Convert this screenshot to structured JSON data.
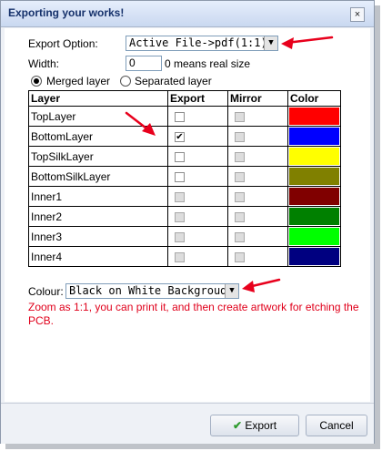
{
  "window": {
    "title": "Exporting your works!",
    "close_label": "×"
  },
  "export_option": {
    "label": "Export Option:",
    "value": "Active File->pdf(1:1)"
  },
  "width": {
    "label": "Width:",
    "value": "0",
    "hint": "0 means real size"
  },
  "layer_mode": {
    "merged_label": "Merged layer",
    "separated_label": "Separated layer",
    "selected": "merged"
  },
  "table": {
    "headers": {
      "layer": "Layer",
      "export": "Export",
      "mirror": "Mirror",
      "color": "Color"
    },
    "rows": [
      {
        "name": "TopLayer",
        "export": false,
        "export_enabled": true,
        "mirror_enabled": false,
        "color": "#ff0000"
      },
      {
        "name": "BottomLayer",
        "export": true,
        "export_enabled": true,
        "mirror_enabled": false,
        "color": "#0000ff"
      },
      {
        "name": "TopSilkLayer",
        "export": false,
        "export_enabled": true,
        "mirror_enabled": false,
        "color": "#ffff00"
      },
      {
        "name": "BottomSilkLayer",
        "export": false,
        "export_enabled": true,
        "mirror_enabled": false,
        "color": "#808000"
      },
      {
        "name": "Inner1",
        "export": false,
        "export_enabled": false,
        "mirror_enabled": false,
        "color": "#800000"
      },
      {
        "name": "Inner2",
        "export": false,
        "export_enabled": false,
        "mirror_enabled": false,
        "color": "#008000"
      },
      {
        "name": "Inner3",
        "export": false,
        "export_enabled": false,
        "mirror_enabled": false,
        "color": "#00ff00"
      },
      {
        "name": "Inner4",
        "export": false,
        "export_enabled": false,
        "mirror_enabled": false,
        "color": "#000080"
      }
    ]
  },
  "colour": {
    "label": "Colour:",
    "value": "Black on White Backgroud"
  },
  "note": "Zoom as 1:1, you can print it, and then create artwork for etching the PCB.",
  "buttons": {
    "export": "Export",
    "cancel": "Cancel"
  },
  "colors": {
    "annotation_arrow": "#e8001c",
    "note_text": "#e0001b"
  }
}
